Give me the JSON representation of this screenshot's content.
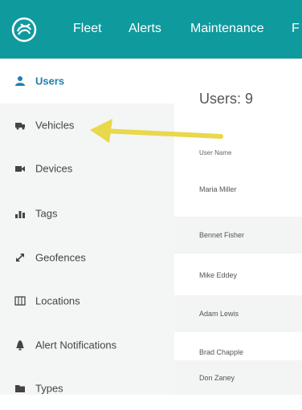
{
  "topbar": {
    "nav": [
      "Fleet",
      "Alerts",
      "Maintenance",
      "F"
    ],
    "logo_icon": "logo-swirl-icon"
  },
  "sidebar": {
    "items": [
      {
        "label": "Users",
        "icon": "user-icon",
        "active": true
      },
      {
        "label": "Vehicles",
        "icon": "truck-icon"
      },
      {
        "label": "Devices",
        "icon": "video-camera-icon"
      },
      {
        "label": "Tags",
        "icon": "tags-icon"
      },
      {
        "label": "Geofences",
        "icon": "expand-icon"
      },
      {
        "label": "Locations",
        "icon": "map-icon"
      },
      {
        "label": "Alert Notifications",
        "icon": "bell-icon"
      },
      {
        "label": "Types",
        "icon": "folder-icon"
      }
    ]
  },
  "main": {
    "title": "Users: 9",
    "column_header": "User Name",
    "rows": [
      "Maria Miller",
      "Bennet Fisher",
      "Mike Eddey",
      "Adam Lewis",
      "Brad Chapple",
      "Don Zaney"
    ]
  },
  "colors": {
    "brand": "#0f9a9e",
    "accent": "#1f7fb0",
    "annotation_arrow": "#e8d84a"
  }
}
